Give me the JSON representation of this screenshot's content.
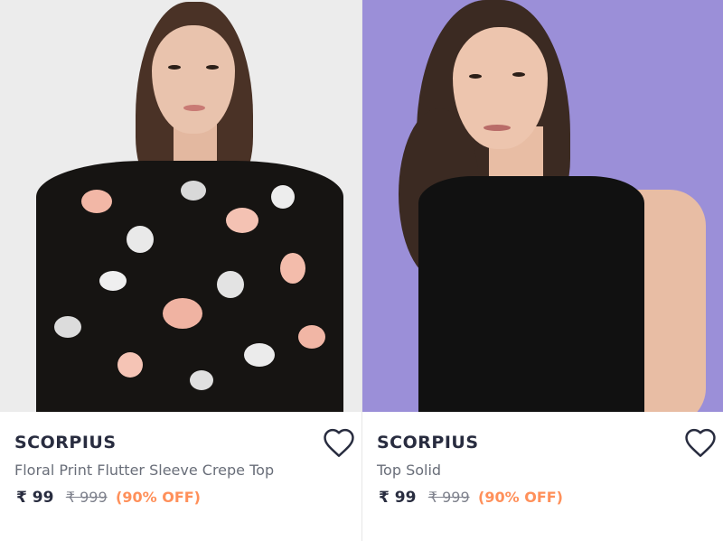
{
  "products": [
    {
      "brand": "SCORPIUS",
      "title": "Floral Print Flutter Sleeve Crepe Top",
      "price": "₹ 99",
      "mrp": "₹ 999",
      "discount": "(90% OFF)",
      "image_alt": "Model wearing black floral print flutter sleeve top"
    },
    {
      "brand": "SCORPIUS",
      "title": "Top Solid",
      "price": "₹ 99",
      "mrp": "₹ 999",
      "discount": "(90% OFF)",
      "image_alt": "Model wearing black solid sleeveless top"
    }
  ],
  "icons": {
    "wishlist": "heart-outline-icon"
  },
  "colors": {
    "brand_text": "#282c3f",
    "title_text": "#696e79",
    "mrp_text": "#7e818c",
    "discount_text": "#ff905a",
    "card1_background": "#ececec",
    "card2_background": "#9b8fd8"
  }
}
